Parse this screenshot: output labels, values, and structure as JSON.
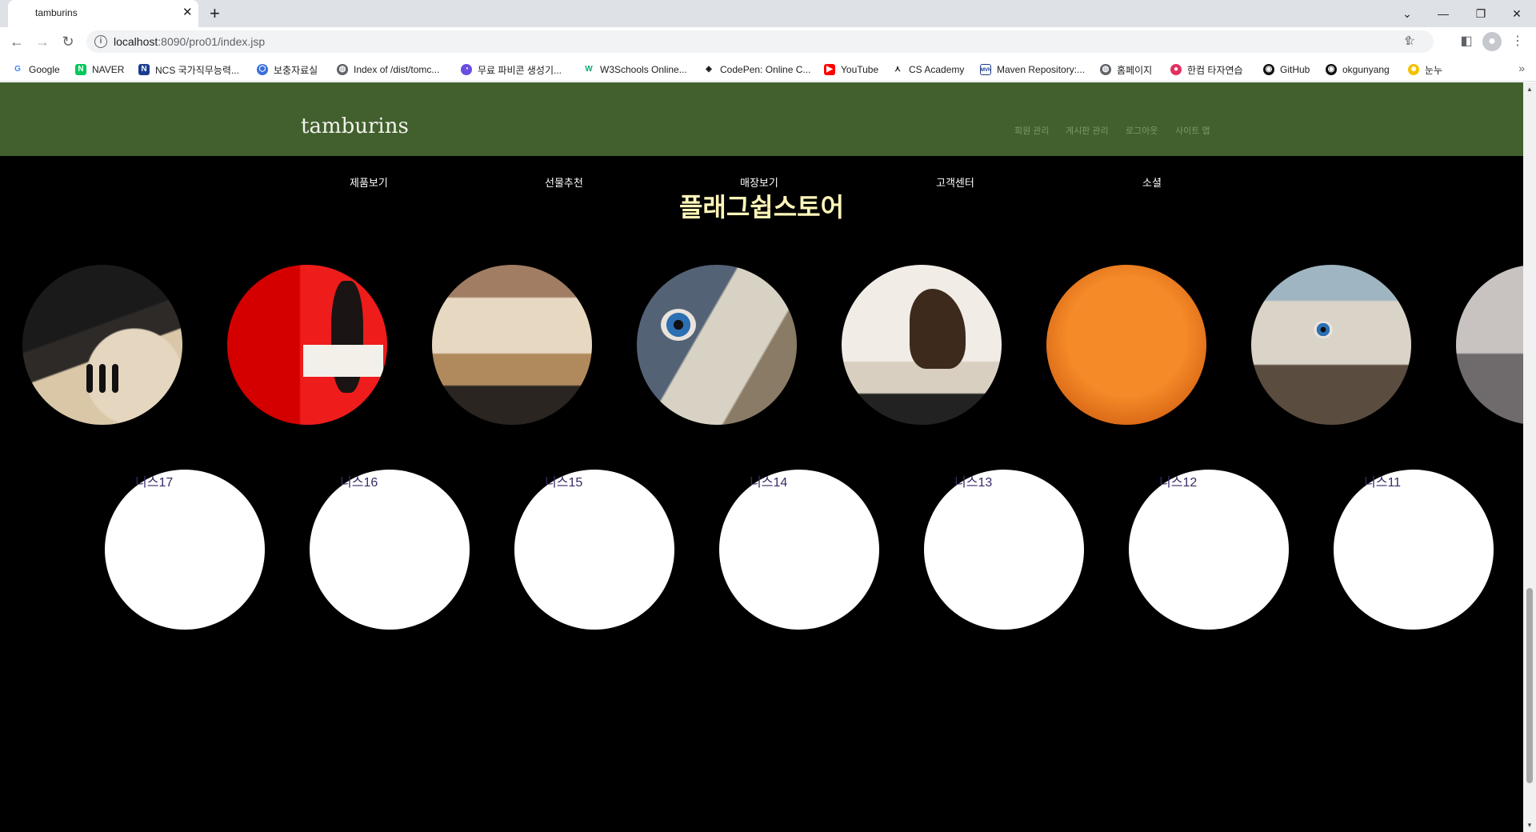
{
  "browser": {
    "tab_title": "tamburins",
    "url_host": "localhost",
    "url_rest": ":8090/pro01/index.jsp",
    "bookmarks": [
      "Google",
      "NAVER",
      "NCS 국가직무능력...",
      "보충자료실",
      "Index of /dist/tomc...",
      "무료 파비콘 생성기...",
      "W3Schools Online...",
      "CodePen: Online C...",
      "YouTube",
      "CS Academy",
      "Maven Repository:...",
      "홈페이지",
      "한컴 타자연습",
      "GitHub",
      "okgunyang",
      "눈누"
    ]
  },
  "site": {
    "logo": "tamburins",
    "util_links": [
      "회원 관리",
      "게시판 관리",
      "로그아웃",
      "사이트 맵"
    ],
    "nav": [
      "제품보기",
      "선물추천",
      "매장보기",
      "고객센터",
      "소셜"
    ],
    "section_title": "플래그쉽스토어",
    "white_labels": [
      "니스17",
      "니스16",
      "니스15",
      "니스14",
      "니스13",
      "니스12",
      "니스11"
    ]
  },
  "colors": {
    "header_green": "#41602e",
    "title_yellow": "#fff5b8",
    "background": "#000000"
  }
}
